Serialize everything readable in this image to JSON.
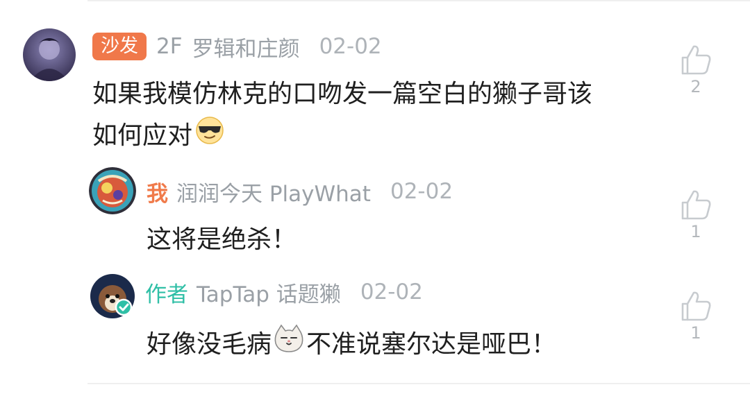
{
  "comment": {
    "badge": "沙发",
    "floor": "2F",
    "username": "罗辑和庄颜",
    "time": "02-02",
    "content_line1": "如果我模仿林克的口吻发一篇空白的獭子哥该",
    "content_line2": "如何应对",
    "likes": "2",
    "avatar_icon": "user-avatar",
    "like_icon": "thumbs-up-icon"
  },
  "replies": [
    {
      "tag": "我",
      "username": "润润今天 PlayWhat",
      "time": "02-02",
      "content": "这将是绝杀！",
      "likes": "1",
      "avatar_icon": "user-avatar"
    },
    {
      "tag": "作者",
      "username": "TapTap 话题獭",
      "time": "02-02",
      "content_before": "好像没毛病",
      "content_after": "不准说塞尔达是哑巴！",
      "likes": "1",
      "avatar_icon": "otter-avatar",
      "verified_icon": "verified-check-icon"
    }
  ],
  "colors": {
    "badge_sofa": "#f0784a",
    "tag_me": "#f07a4a",
    "tag_author": "#2fbfa6",
    "meta_gray": "#9aa0a6",
    "content_text": "#1f1f1f"
  }
}
